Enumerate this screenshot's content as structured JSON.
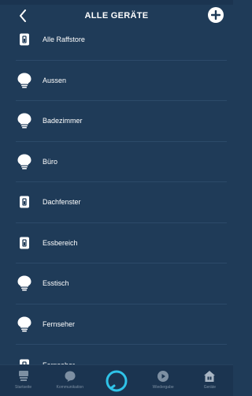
{
  "header": {
    "title": "ALLE GERÄTE"
  },
  "devices": [
    {
      "label": "Alle Raffstore",
      "icon": "blind-switch-icon"
    },
    {
      "label": "Aussen",
      "icon": "bulb-icon"
    },
    {
      "label": "Badezimmer",
      "icon": "bulb-icon"
    },
    {
      "label": "Büro",
      "icon": "bulb-icon"
    },
    {
      "label": "Dachfenster",
      "icon": "blind-switch-icon"
    },
    {
      "label": "Essbereich",
      "icon": "blind-switch-icon"
    },
    {
      "label": "Esstisch",
      "icon": "bulb-icon"
    },
    {
      "label": "Fernseher",
      "icon": "bulb-icon"
    },
    {
      "label": "Fernseher",
      "icon": "blind-switch-icon"
    }
  ],
  "nav": {
    "home": "Startseite",
    "communication": "Kommunikation",
    "play": "Wiedergabe",
    "devices": "Geräte"
  },
  "colors": {
    "background": "#1f3b58",
    "alexa_ring": "#2fc3e8",
    "nav_active": "#a9b6c4"
  }
}
